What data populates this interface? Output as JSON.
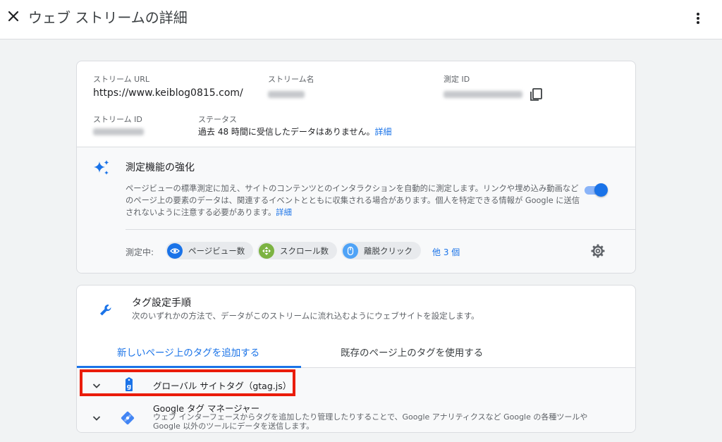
{
  "header": {
    "title": "ウェブ ストリームの詳細"
  },
  "stream": {
    "url_label": "ストリーム URL",
    "url_value": "https://www.keiblog0815.com/",
    "name_label": "ストリーム名",
    "measurement_label": "測定 ID",
    "id_label": "ストリーム ID",
    "status_label": "ステータス",
    "status_text": "過去 48 時間に受信したデータはありません。",
    "status_link": "詳細"
  },
  "enhanced": {
    "title": "測定機能の強化",
    "description": "ページビューの標準測定に加え、サイトのコンテンツとのインタラクションを自動的に測定します。リンクや埋め込み動画などのページ上の要素のデータは、関連するイベントとともに収集される場合があります。個人を特定できる情報が Google に送信されないように注意する必要があります。",
    "description_link": "詳細",
    "toggle_on": true,
    "measuring_label": "測定中:",
    "chips": [
      {
        "label": "ページビュー数",
        "icon": "eye-icon",
        "color": "#1a73e8"
      },
      {
        "label": "スクロール数",
        "icon": "scroll-icon",
        "color": "#7cb342"
      },
      {
        "label": "離脱クリック",
        "icon": "mouse-icon",
        "color": "#4fa3f7"
      }
    ],
    "more_link": "他 3 個"
  },
  "tagging": {
    "title": "タグ設定手順",
    "description": "次のいずれかの方法で、データがこのストリームに流れ込むようにウェブサイトを設定します。",
    "tabs": [
      {
        "label": "新しいページ上のタグを追加する",
        "active": true
      },
      {
        "label": "既存のページ上のタグを使用する",
        "active": false
      }
    ],
    "rows": [
      {
        "title": "グローバル サイトタグ（gtag.js）",
        "icon": "gtag-icon"
      },
      {
        "title": "Google タグ マネージャー",
        "description": "ウェブ インターフェースからタグを追加したり管理したりすることで、Google アナリティクスなど Google の各種ツールや Google 以外のツールにデータを送信します。",
        "icon": "gtm-icon"
      }
    ]
  },
  "colors": {
    "accent": "#1a73e8",
    "highlight_box": "#ea1c0a"
  }
}
